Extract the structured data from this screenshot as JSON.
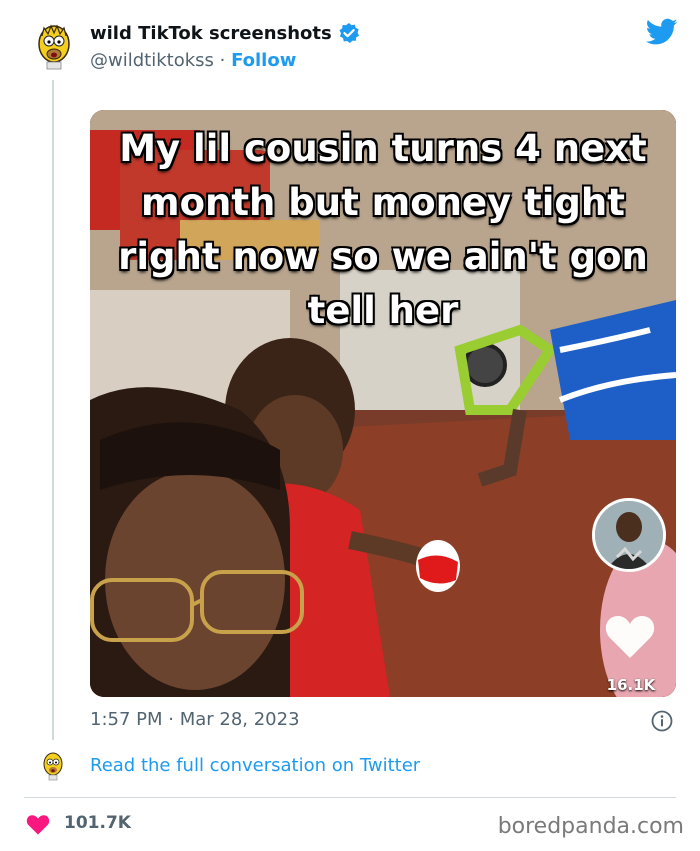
{
  "tweet": {
    "display_name": "wild TikTok screenshots",
    "handle": "@wildtiktokss",
    "separator": " · ",
    "follow_label": "Follow",
    "timestamp": "1:57 PM · Mar 28, 2023",
    "read_more": "Read the full conversation on Twitter",
    "like_count": "101.7K"
  },
  "media": {
    "caption": "My lil cousin turns 4 next month but money tight right now so we ain't gon tell her",
    "tiktok_likes": "16.1K"
  },
  "watermark": "boredpanda.com",
  "colors": {
    "twitter_blue": "#1d9bf0",
    "heart": "#f91880",
    "text_secondary": "#536471"
  },
  "icons": [
    "avatar-icon",
    "verified-badge-icon",
    "twitter-bird-icon",
    "heart-icon",
    "info-icon"
  ]
}
